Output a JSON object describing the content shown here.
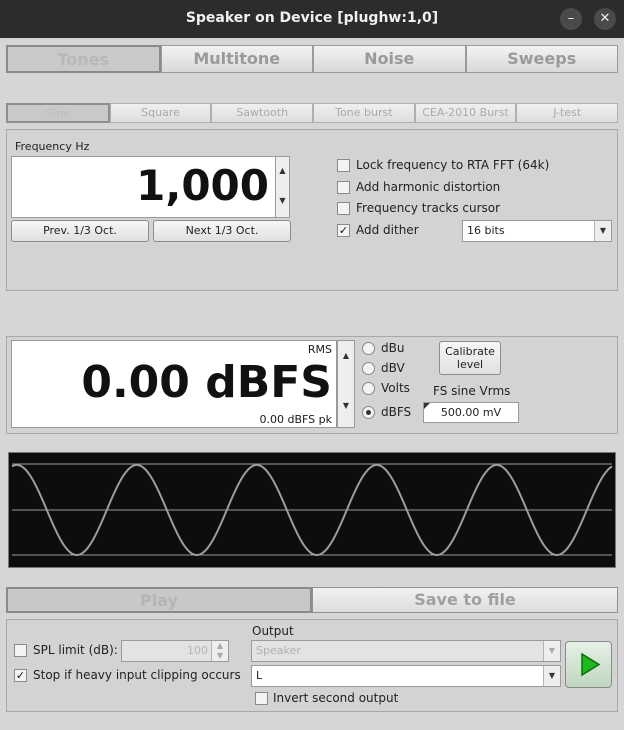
{
  "window": {
    "title": "Speaker on Device [plughw:1,0]",
    "minimize_glyph": "–",
    "close_glyph": "✕"
  },
  "tabs_primary": [
    "Tones",
    "Multitone",
    "Noise",
    "Sweeps"
  ],
  "tabs_secondary": [
    "Sine",
    "Square",
    "Sawtooth",
    "Tone burst",
    "CEA-2010 Burst",
    "J-test"
  ],
  "frequency": {
    "label": "Frequency Hz",
    "value": "1,000",
    "prev_button": "Prev. 1/3 Oct.",
    "next_button": "Next 1/3 Oct."
  },
  "options": {
    "lock_rta": {
      "label": "Lock frequency to RTA FFT (64k)",
      "checked": false
    },
    "harmonic": {
      "label": "Add harmonic distortion",
      "checked": false
    },
    "tracks_cursor": {
      "label": "Frequency tracks cursor",
      "checked": false
    },
    "dither": {
      "label": "Add dither",
      "checked": true,
      "bits": "16 bits"
    }
  },
  "level": {
    "rms_label": "RMS",
    "value": "0.00 dBFS",
    "peak": "0.00 dBFS pk",
    "units": [
      "dBu",
      "dBV",
      "Volts",
      "dBFS"
    ],
    "selected_unit": "dBFS",
    "calibrate_line1": "Calibrate",
    "calibrate_line2": "level",
    "fs_label": "FS sine Vrms",
    "fs_value": "500.00 mV"
  },
  "actions": {
    "play": "Play",
    "save": "Save to file"
  },
  "bottom": {
    "spl_label": "SPL limit (dB):",
    "spl_value": "100",
    "spl_checked": false,
    "stop_label": "Stop if heavy input clipping occurs",
    "stop_checked": true,
    "output_label": "Output",
    "output_device": "Speaker",
    "output_channel": "L",
    "invert_label": "Invert second output",
    "invert_checked": false
  },
  "colors": {
    "scope_bg": "#0d0d0d",
    "scope_wave": "#9c9c9c",
    "play_green": "#1fb81f"
  },
  "scope": {
    "cycles": 5
  }
}
